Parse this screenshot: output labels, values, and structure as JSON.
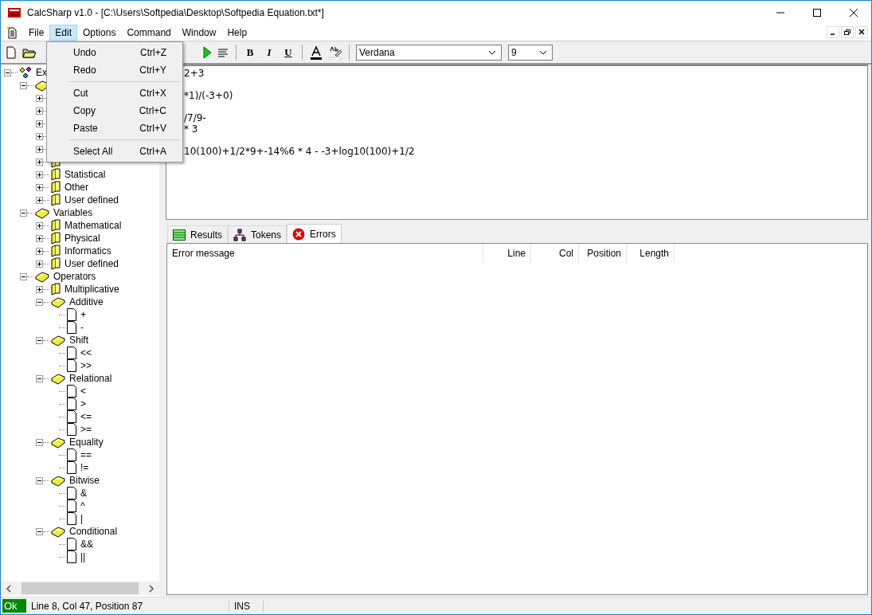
{
  "window": {
    "title": "CalcSharp v1.0 - [C:\\Users\\Softpedia\\Desktop\\Softpedia Equation.txt*]"
  },
  "menu_bar": [
    {
      "label": "File",
      "selected": false
    },
    {
      "label": "Edit",
      "selected": true
    },
    {
      "label": "Options",
      "selected": false
    },
    {
      "label": "Command",
      "selected": false
    },
    {
      "label": "Window",
      "selected": false
    },
    {
      "label": "Help",
      "selected": false
    }
  ],
  "edit_menu": [
    {
      "kind": "item",
      "label": "Undo",
      "shortcut": "Ctrl+Z"
    },
    {
      "kind": "item",
      "label": "Redo",
      "shortcut": "Ctrl+Y"
    },
    {
      "kind": "separator"
    },
    {
      "kind": "item",
      "label": "Cut",
      "shortcut": "Ctrl+X"
    },
    {
      "kind": "item",
      "label": "Copy",
      "shortcut": "Ctrl+C"
    },
    {
      "kind": "item",
      "label": "Paste",
      "shortcut": "Ctrl+V"
    },
    {
      "kind": "separator"
    },
    {
      "kind": "item",
      "label": "Select All",
      "shortcut": "Ctrl+A"
    }
  ],
  "toolbar": {
    "format_buttons": [
      "B",
      "I",
      "U"
    ],
    "font": "Verdana",
    "size": "9"
  },
  "tree": [
    {
      "kind": "root",
      "label": "Ex",
      "expanded": true,
      "children": [
        {
          "kind": "folder",
          "expanded": true,
          "children": [
            {
              "kind": "folder",
              "expanded": false
            },
            {
              "kind": "folder",
              "expanded": false
            },
            {
              "kind": "folder",
              "expanded": false
            },
            {
              "kind": "folder",
              "expanded": false
            },
            {
              "kind": "folder",
              "expanded": false
            },
            {
              "kind": "folder",
              "expanded": false
            },
            {
              "kind": "folder",
              "label": "Statistical",
              "expanded": false
            },
            {
              "kind": "folder",
              "label": "Other",
              "expanded": false
            },
            {
              "kind": "folder",
              "label": "User defined",
              "expanded": false
            }
          ]
        },
        {
          "kind": "folder",
          "label": "Variables",
          "expanded": true,
          "children": [
            {
              "kind": "folder",
              "label": "Mathematical",
              "expanded": false
            },
            {
              "kind": "folder",
              "label": "Physical",
              "expanded": false
            },
            {
              "kind": "folder",
              "label": "Informatics",
              "expanded": false
            },
            {
              "kind": "folder",
              "label": "User defined",
              "expanded": false
            }
          ]
        },
        {
          "kind": "folder",
          "label": "Operators",
          "expanded": true,
          "children": [
            {
              "kind": "folder",
              "label": "Multiplicative",
              "expanded": false
            },
            {
              "kind": "folder",
              "label": "Additive",
              "expanded": true,
              "children": [
                {
                  "kind": "leaf",
                  "label": "+"
                },
                {
                  "kind": "leaf",
                  "label": "-"
                }
              ]
            },
            {
              "kind": "folder",
              "label": "Shift",
              "expanded": true,
              "children": [
                {
                  "kind": "leaf",
                  "label": "<<"
                },
                {
                  "kind": "leaf",
                  "label": ">>"
                }
              ]
            },
            {
              "kind": "folder",
              "label": "Relational",
              "expanded": true,
              "children": [
                {
                  "kind": "leaf",
                  "label": "<"
                },
                {
                  "kind": "leaf",
                  "label": ">"
                },
                {
                  "kind": "leaf",
                  "label": "<="
                },
                {
                  "kind": "leaf",
                  "label": ">="
                }
              ]
            },
            {
              "kind": "folder",
              "label": "Equality",
              "expanded": true,
              "children": [
                {
                  "kind": "leaf",
                  "label": "=="
                },
                {
                  "kind": "leaf",
                  "label": "!="
                }
              ]
            },
            {
              "kind": "folder",
              "label": "Bitwise",
              "expanded": true,
              "children": [
                {
                  "kind": "leaf",
                  "label": "&"
                },
                {
                  "kind": "leaf",
                  "label": "^"
                },
                {
                  "kind": "leaf",
                  "label": "|"
                }
              ]
            },
            {
              "kind": "folder",
              "label": "Conditional",
              "expanded": true,
              "children": [
                {
                  "kind": "leaf",
                  "label": "&&"
                },
                {
                  "kind": "leaf",
                  "label": "||"
                }
              ]
            }
          ]
        }
      ]
    }
  ],
  "editor": {
    "paragraphs": [
      [
        "2+3"
      ],
      [
        "*1)/(-3+0)"
      ],
      [
        "/7/9-",
        "* 3"
      ],
      [
        "10(100)+1/2*9+-14%6 * 4 - -3+log10(100)+1/2"
      ]
    ]
  },
  "tabs": [
    {
      "label": "Results",
      "selected": false
    },
    {
      "label": "Tokens",
      "selected": false
    },
    {
      "label": "Errors",
      "selected": true
    }
  ],
  "error_table": {
    "columns": [
      "Error message",
      "Line",
      "Col",
      "Position",
      "Length"
    ]
  },
  "status_bar": {
    "state": "Ok",
    "position": "Line 8, Col 47, Position 87",
    "mode": "INS"
  }
}
